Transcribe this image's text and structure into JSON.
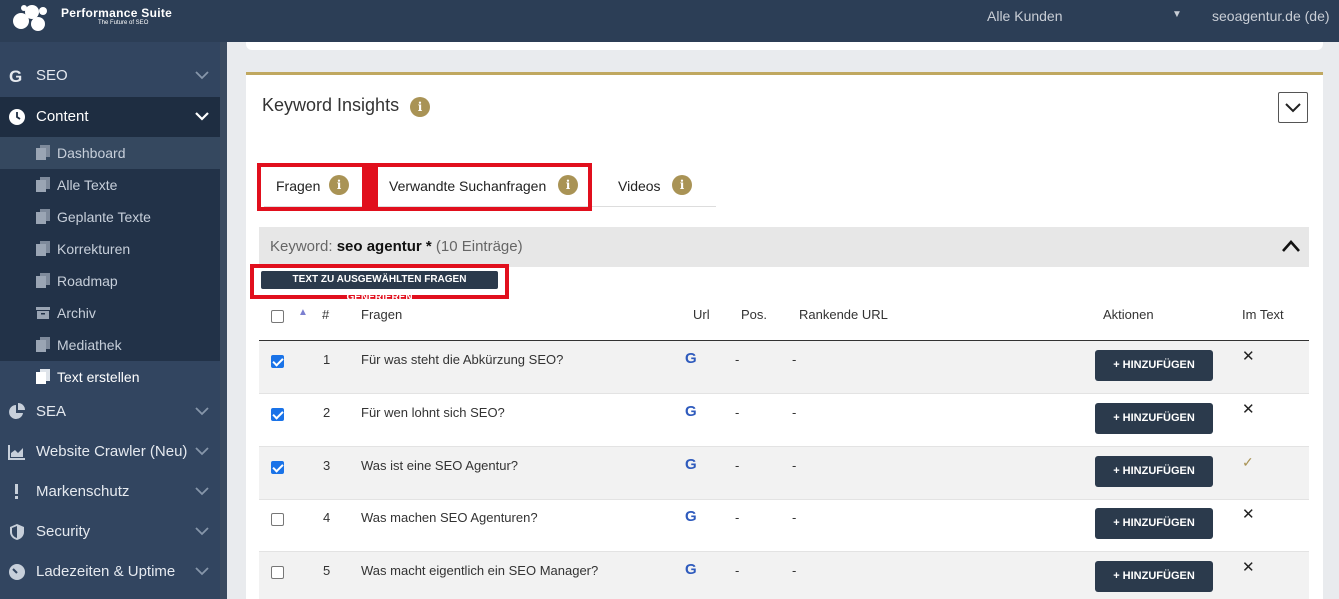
{
  "header": {
    "brand": "Performance Suite",
    "brand_sub": "The Future of SEO",
    "customer_select": "Alle Kunden",
    "account": "seoagentur.de (de)"
  },
  "sidebar": {
    "items": [
      {
        "label": "SEO",
        "icon": "google-g-icon"
      },
      {
        "label": "Content",
        "icon": "clock-icon"
      },
      {
        "label": "SEA",
        "icon": "pie-chart-icon"
      },
      {
        "label": "Website Crawler (Neu)",
        "icon": "area-chart-icon"
      },
      {
        "label": "Markenschutz",
        "icon": "exclamation-icon"
      },
      {
        "label": "Security",
        "icon": "shield-icon"
      },
      {
        "label": "Ladezeiten & Uptime",
        "icon": "gauge-icon"
      }
    ],
    "submenu": [
      {
        "label": "Dashboard"
      },
      {
        "label": "Alle Texte"
      },
      {
        "label": "Geplante Texte"
      },
      {
        "label": "Korrekturen"
      },
      {
        "label": "Roadmap"
      },
      {
        "label": "Archiv"
      },
      {
        "label": "Mediathek"
      },
      {
        "label": "Text erstellen"
      }
    ]
  },
  "card": {
    "title": "Keyword Insights",
    "tabs": [
      {
        "label": "Fragen"
      },
      {
        "label": "Verwandte Suchanfragen"
      },
      {
        "label": "Videos"
      }
    ],
    "keyword_prefix": "Keyword: ",
    "keyword": "seo agentur *",
    "keyword_count": " (10 Einträge)",
    "generate_button": "TEXT ZU AUSGEWÄHLTEN FRAGEN GENERIEREN"
  },
  "table": {
    "columns": {
      "sort": "▲",
      "num": "#",
      "question": "Fragen",
      "url": "Url",
      "pos": "Pos.",
      "ranking_url": "Rankende URL",
      "actions": "Aktionen",
      "in_text": "Im Text"
    },
    "add_label": "+ HINZUFÜGEN",
    "rows": [
      {
        "num": "1",
        "question": "Für was steht die Abkürzung SEO?",
        "pos": "-",
        "ranking_url": "-",
        "checked": true,
        "in_text": "✕"
      },
      {
        "num": "2",
        "question": "Für wen lohnt sich SEO?",
        "pos": "-",
        "ranking_url": "-",
        "checked": true,
        "in_text": "✕"
      },
      {
        "num": "3",
        "question": "Was ist eine SEO Agentur?",
        "pos": "-",
        "ranking_url": "-",
        "checked": true,
        "in_text": "✓"
      },
      {
        "num": "4",
        "question": "Was machen SEO Agenturen?",
        "pos": "-",
        "ranking_url": "-",
        "checked": false,
        "in_text": "✕"
      },
      {
        "num": "5",
        "question": "Was macht eigentlich ein SEO Manager?",
        "pos": "-",
        "ranking_url": "-",
        "checked": false,
        "in_text": "✕"
      }
    ]
  },
  "colors": {
    "sidebar": "#324560",
    "accent_gold": "#a99355",
    "highlight_red": "#e10f1d",
    "button_dark": "#2b3a4c"
  }
}
